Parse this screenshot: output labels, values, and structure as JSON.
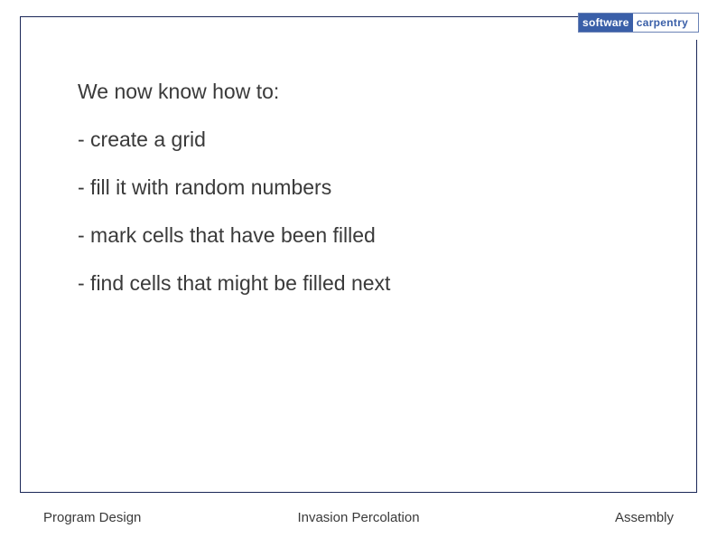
{
  "logo": {
    "left": "software",
    "right": "carpentry",
    "tagline": ""
  },
  "content": {
    "heading": "We now know how to:",
    "bullets": [
      "- create a grid",
      "- fill it with random numbers",
      "- mark cells that have been filled",
      "- find cells that might be filled next"
    ]
  },
  "footer": {
    "left": "Program Design",
    "center": "Invasion Percolation",
    "right": "Assembly"
  }
}
